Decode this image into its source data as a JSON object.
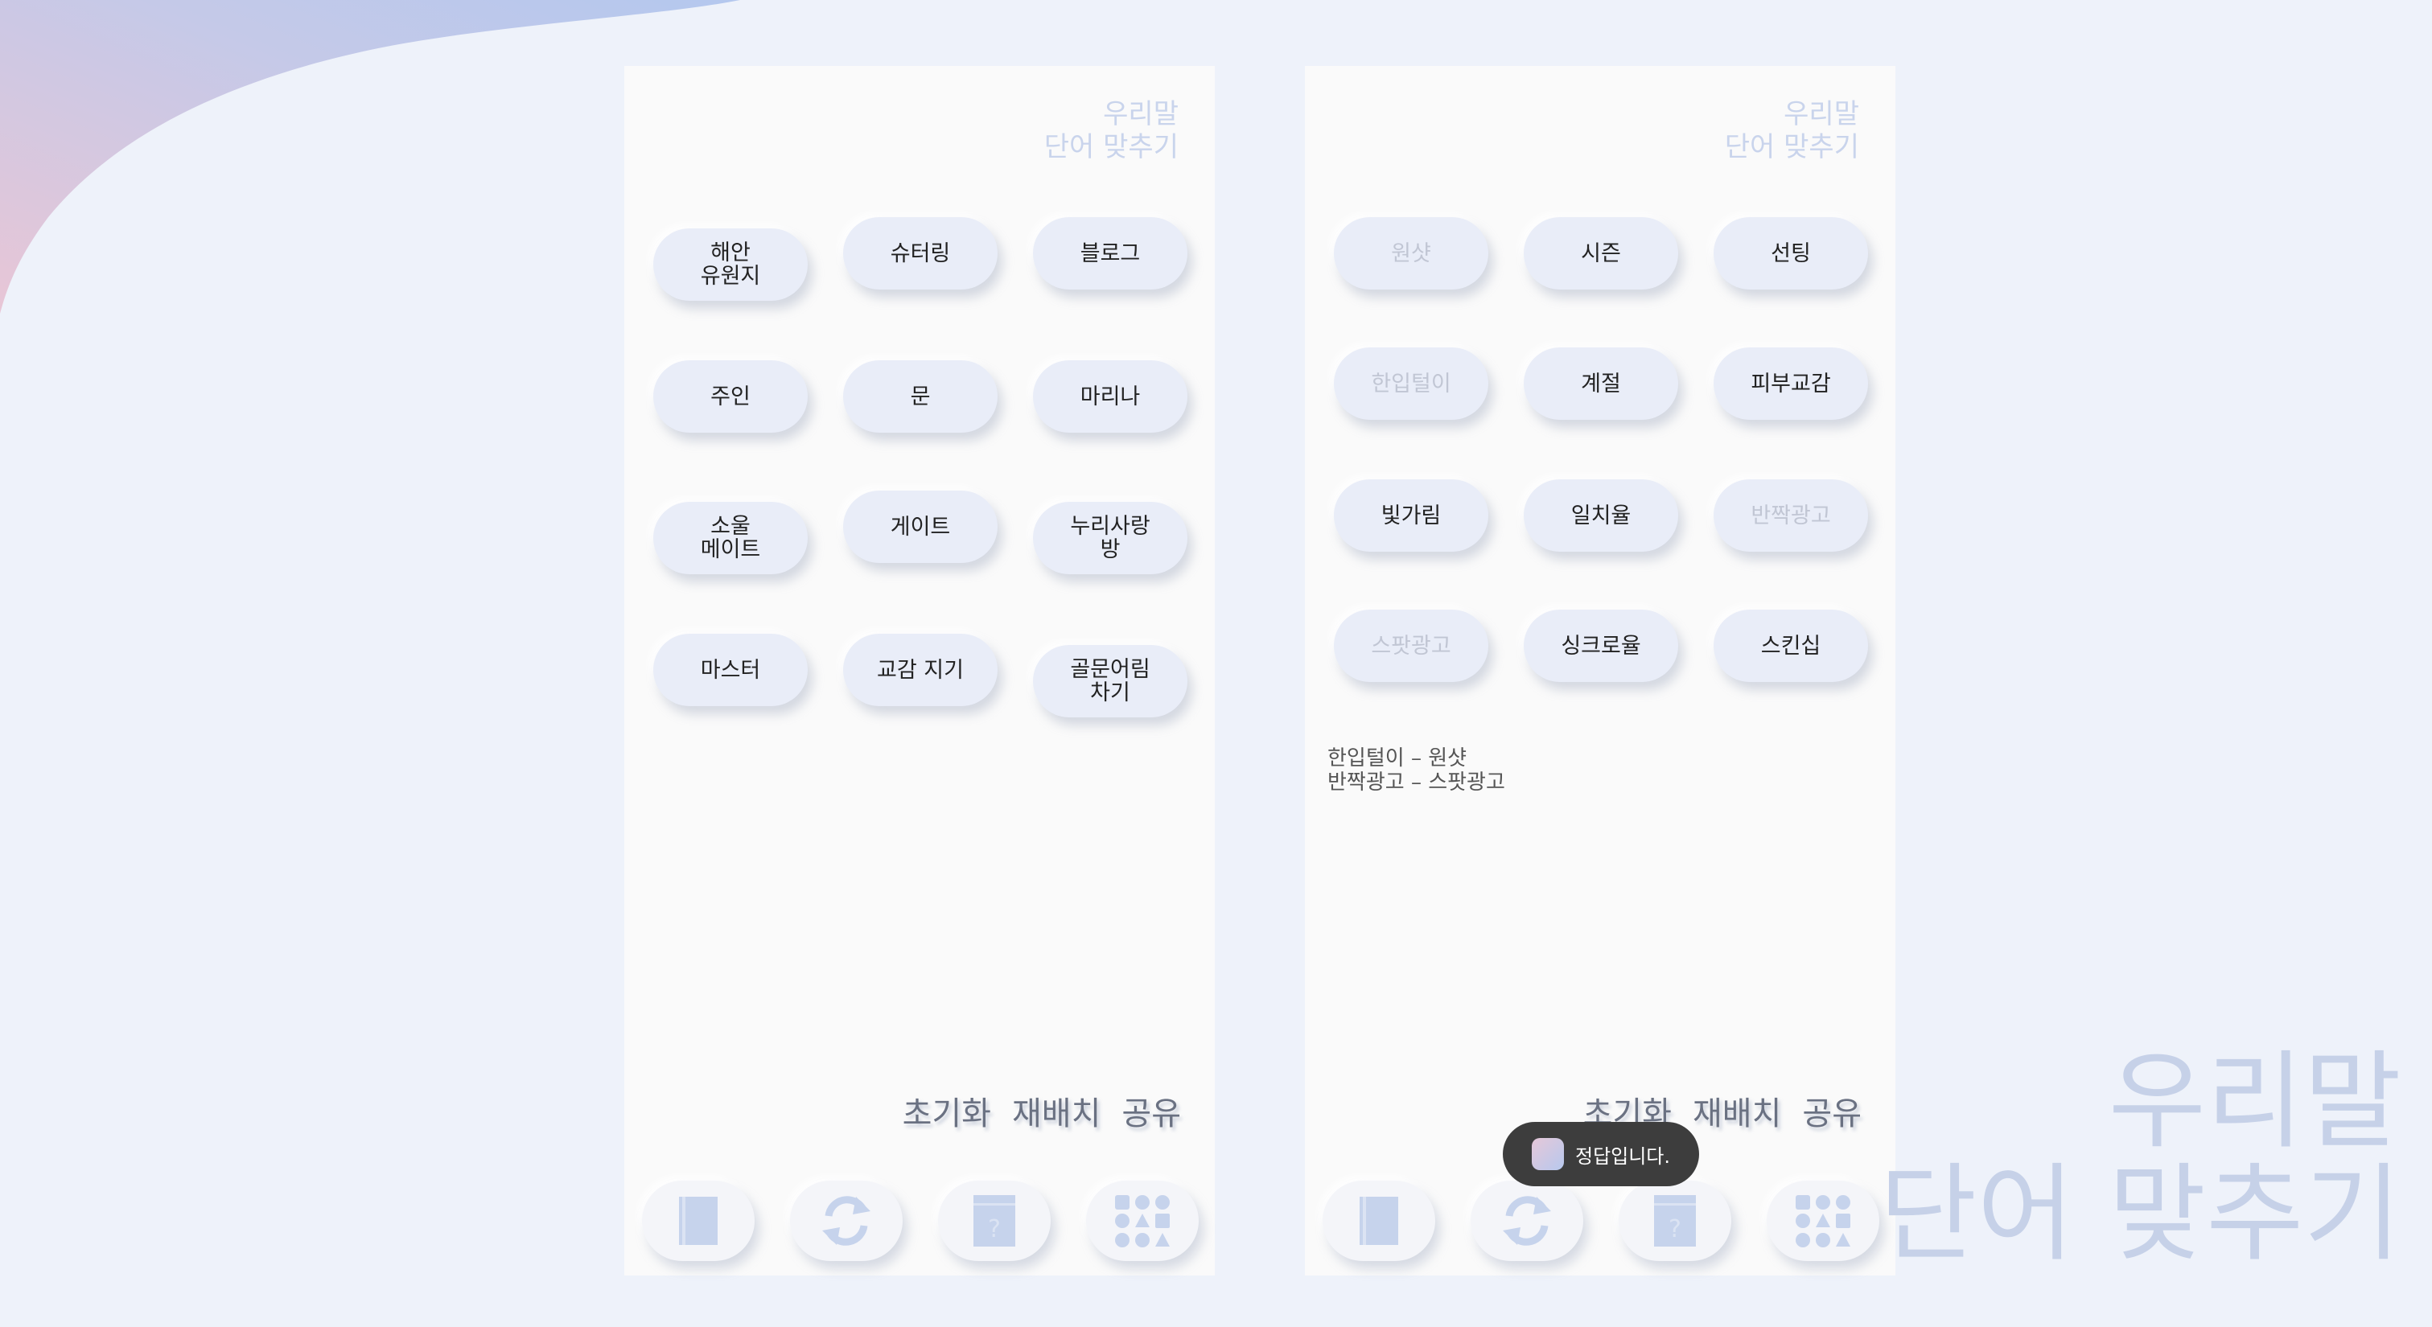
{
  "app_title_line1": "우리말",
  "app_title_line2": "단어 맞추기",
  "colors": {
    "background": "#eef2fa",
    "tile": "#e9edf8",
    "matched_text": "#c1c6d4",
    "accent": "#c9d4ec"
  },
  "left_screen": {
    "tiles": [
      {
        "label": "해안\n유원지",
        "state": "active"
      },
      {
        "label": "슈터링",
        "state": "active"
      },
      {
        "label": "블로그",
        "state": "active"
      },
      {
        "label": "주인",
        "state": "active"
      },
      {
        "label": "문",
        "state": "active"
      },
      {
        "label": "마리나",
        "state": "active"
      },
      {
        "label": "소울\n메이트",
        "state": "active"
      },
      {
        "label": "게이트",
        "state": "active"
      },
      {
        "label": "누리사랑\n방",
        "state": "active"
      },
      {
        "label": "마스터",
        "state": "active"
      },
      {
        "label": "교감 지기",
        "state": "active"
      },
      {
        "label": "골문어림\n차기",
        "state": "active"
      }
    ]
  },
  "right_screen": {
    "tiles": [
      {
        "label": "원샷",
        "state": "matched"
      },
      {
        "label": "시즌",
        "state": "active"
      },
      {
        "label": "선팅",
        "state": "active"
      },
      {
        "label": "한입털이",
        "state": "matched"
      },
      {
        "label": "계절",
        "state": "active"
      },
      {
        "label": "피부교감",
        "state": "active"
      },
      {
        "label": "빛가림",
        "state": "active"
      },
      {
        "label": "일치율",
        "state": "active"
      },
      {
        "label": "반짝광고",
        "state": "matched"
      },
      {
        "label": "스팟광고",
        "state": "matched"
      },
      {
        "label": "싱크로율",
        "state": "active"
      },
      {
        "label": "스킨십",
        "state": "active"
      }
    ],
    "matches": [
      "한입털이 – 원샷",
      "반짝광고 – 스팟광고"
    ],
    "toast": "정답입니다."
  },
  "actions": {
    "reset": "초기화",
    "shuffle": "재배치",
    "share": "공유"
  },
  "nav_icons": [
    "book-icon",
    "refresh-icon",
    "help-card-icon",
    "shapes-grid-icon"
  ]
}
